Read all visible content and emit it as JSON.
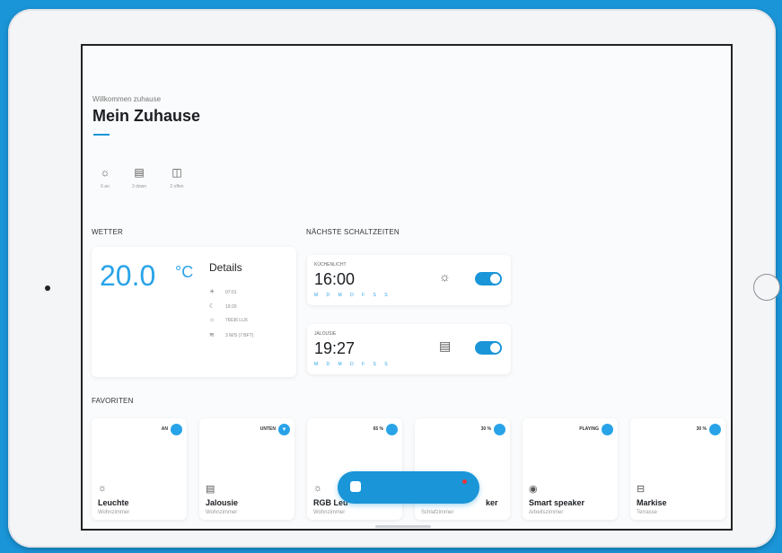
{
  "header": {
    "welcome": "Willkommen zuhause",
    "title": "Mein Zuhause"
  },
  "summary": [
    {
      "icon": "lightbulb-icon",
      "glyph": "☼",
      "label": "6 an"
    },
    {
      "icon": "blinds-icon",
      "glyph": "▤",
      "label": "3 down"
    },
    {
      "icon": "window-icon",
      "glyph": "◫",
      "label": "2 offen"
    }
  ],
  "weather": {
    "section": "WETTER",
    "temperature": "20.0",
    "unit": "°C",
    "details_title": "Details",
    "rows": [
      {
        "icon": "sunrise-icon",
        "glyph": "☀",
        "value": "07:01"
      },
      {
        "icon": "sunset-icon",
        "glyph": "☾",
        "value": "19:20"
      },
      {
        "icon": "brightness-icon",
        "glyph": "☼",
        "value": "76636 LUX"
      },
      {
        "icon": "wind-icon",
        "glyph": "≋",
        "value": "3 M/S (7 BFT)"
      }
    ]
  },
  "schedule": {
    "section": "NÄCHSTE SCHALTZEITEN",
    "items": [
      {
        "name": "KÜCHENLICHT",
        "time": "16:00",
        "days": "M D M D F S S",
        "icon": "lightbulb-icon",
        "glyph": "☼"
      },
      {
        "name": "JALOUSIE",
        "time": "19:27",
        "days": "M D M D F S S",
        "icon": "blinds-icon",
        "glyph": "▤"
      }
    ]
  },
  "favorites": {
    "section": "FAVORITEN",
    "items": [
      {
        "badge": "AN",
        "dot": "",
        "icon": "lightbulb-icon",
        "glyph": "☼",
        "name": "Leuchte",
        "room": "Wohnzimmer"
      },
      {
        "badge": "UNTEN",
        "dot": "▾",
        "icon": "blinds-icon",
        "glyph": "▤",
        "name": "Jalousie",
        "room": "Wohnzimmer"
      },
      {
        "badge": "65 %",
        "dot": "",
        "icon": "lightbulb-icon",
        "glyph": "☼",
        "name": "RGB Leu",
        "room": "Wohnzimmer"
      },
      {
        "badge": "30 %",
        "dot": "",
        "icon": "speaker-icon",
        "glyph": "◉",
        "name": "ker",
        "room": "Schlafzimmer"
      },
      {
        "badge": "PLAYING",
        "dot": "",
        "icon": "speaker-icon",
        "glyph": "◉",
        "name": "Smart speaker",
        "room": "Arbeitszimmer"
      },
      {
        "badge": "30 %",
        "dot": "",
        "icon": "awning-icon",
        "glyph": "⊟",
        "name": "Markise",
        "room": "Terrasse"
      }
    ]
  },
  "colors": {
    "accent": "#1a95d8",
    "background": "#1a95d8",
    "alert": "#e8333a"
  }
}
